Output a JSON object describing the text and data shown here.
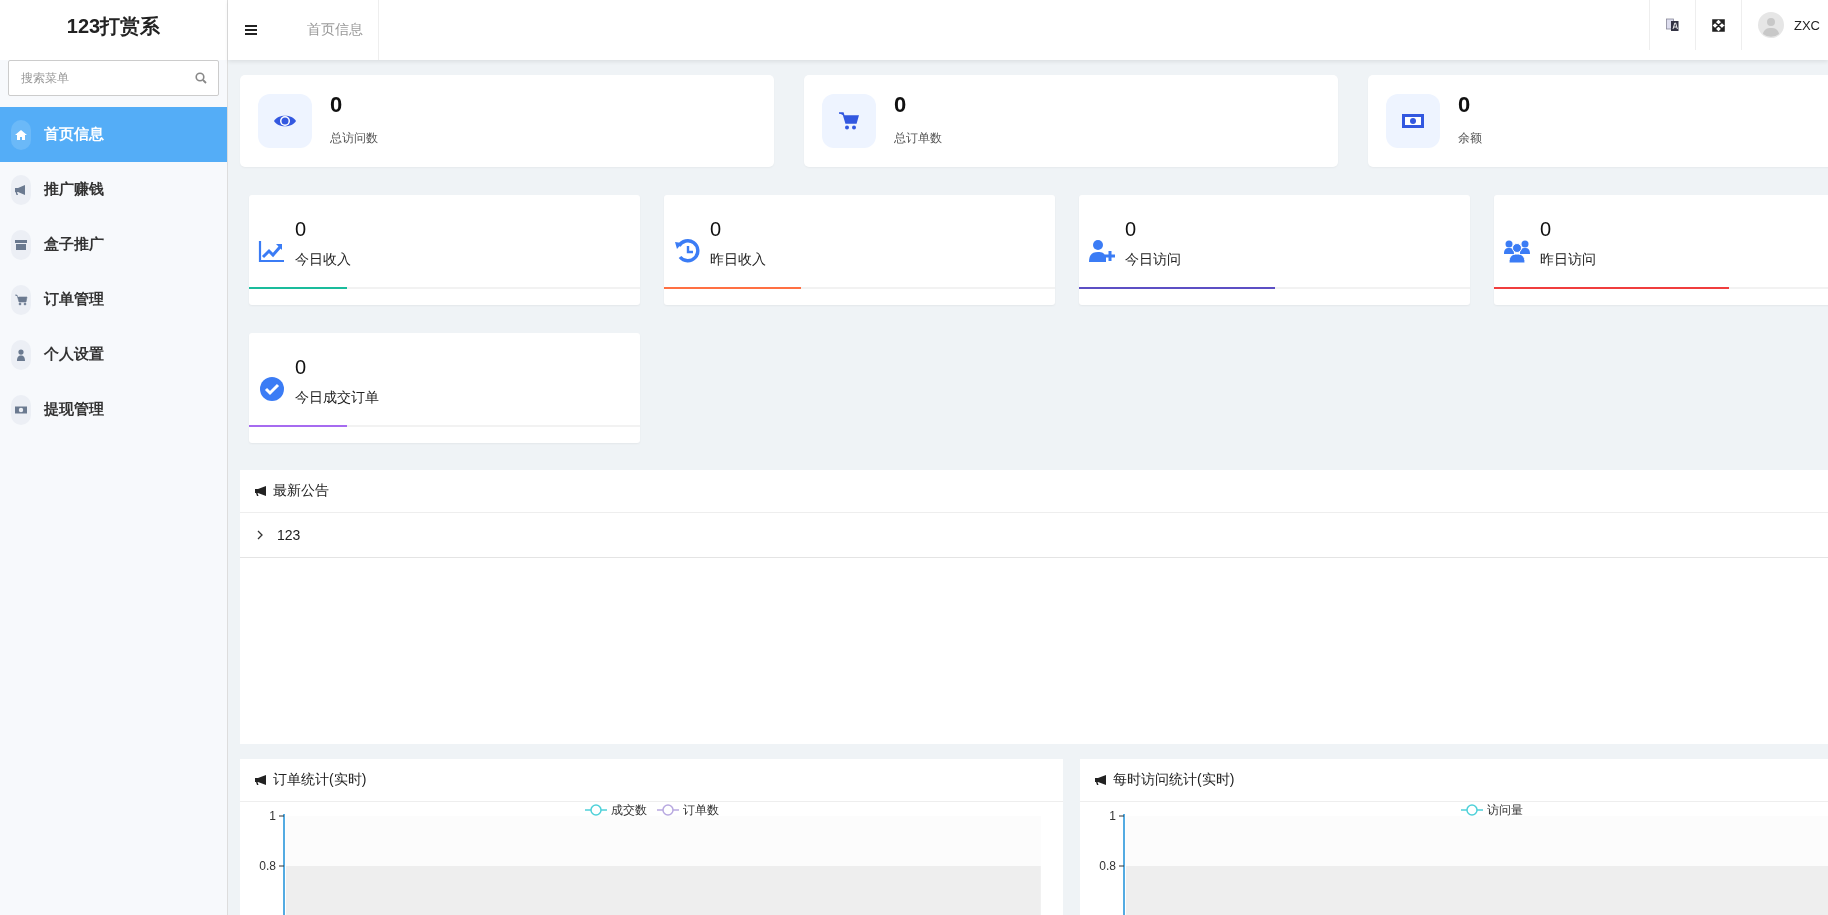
{
  "logo": "123打赏系",
  "topbar": {
    "tabs": [
      {
        "label": "首页信息",
        "selected": false
      }
    ],
    "user": "ZXC"
  },
  "sidebar": {
    "search": {
      "placeholder": "搜索菜单"
    },
    "items": [
      {
        "label": "首页信息",
        "selected": true
      },
      {
        "label": "推广赚钱",
        "selected": false
      },
      {
        "label": "盒子推广",
        "selected": false
      },
      {
        "label": "订单管理",
        "selected": false
      },
      {
        "label": "个人设置",
        "selected": false
      },
      {
        "label": "提现管理",
        "selected": false
      }
    ]
  },
  "summary": [
    {
      "value": "0",
      "label": "总访问数"
    },
    {
      "value": "0",
      "label": "总订单数"
    },
    {
      "value": "0",
      "label": "余额"
    }
  ],
  "stats": [
    {
      "value": "0",
      "label": "今日收入",
      "level": 0.25,
      "color": "#1abc9c"
    },
    {
      "value": "0",
      "label": "昨日收入",
      "level": 0.35,
      "color": "#ff7043"
    },
    {
      "value": "0",
      "label": "今日访问",
      "level": 0.5,
      "color": "#5c4fc4"
    },
    {
      "value": "0",
      "label": "昨日访问",
      "level": 0.6,
      "color": "#f03e3e"
    },
    {
      "value": "0",
      "label": "今日成交订单",
      "level": 0.25,
      "color": "#a66bf0"
    }
  ],
  "notice": {
    "title": "最新公告",
    "items": [
      {
        "text": "123",
        "expanded": false
      }
    ]
  },
  "charts": [
    {
      "title": "订单统计(实时)",
      "legend": [
        {
          "name": "成交数",
          "color": "#4fd1d9"
        },
        {
          "name": "订单数",
          "color": "#b8a9e0"
        }
      ],
      "y_axis_labels": [
        "1",
        "0.8"
      ]
    },
    {
      "title": "每时访问统计(实时)",
      "legend": [
        {
          "name": "访问量",
          "color": "#4fd1d9"
        }
      ],
      "y_axis_labels": [
        "1",
        "0.8"
      ]
    }
  ]
}
